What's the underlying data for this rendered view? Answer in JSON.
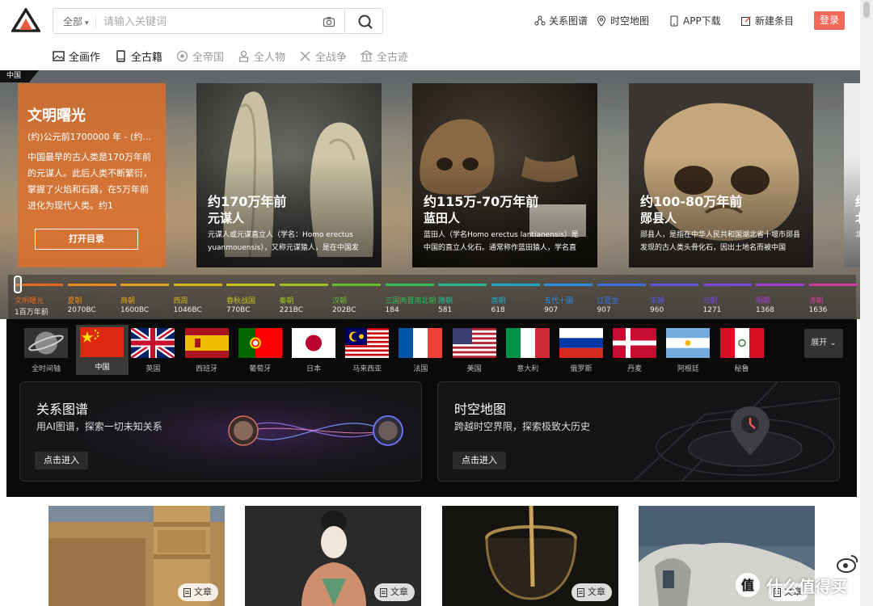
{
  "header": {
    "search": {
      "scope": "全部",
      "placeholder": "请输入关键词"
    },
    "nav": [
      {
        "label": "关系图谱",
        "icon": "relation-graph-icon"
      },
      {
        "label": "时空地图",
        "icon": "map-pin-icon"
      },
      {
        "label": "APP下载",
        "icon": "phone-icon"
      },
      {
        "label": "新建条目",
        "icon": "edit-icon"
      }
    ],
    "login": "登录"
  },
  "categories": [
    {
      "label": "全画作",
      "active": true
    },
    {
      "label": "全古籍",
      "active": true
    },
    {
      "label": "全帝国",
      "active": false
    },
    {
      "label": "全人物",
      "active": false
    },
    {
      "label": "全战争",
      "active": false
    },
    {
      "label": "全古迹",
      "active": false
    }
  ],
  "hero": {
    "region_tag": "中国",
    "intro": {
      "title": "文明曙光",
      "date": "(约)公元前1700000 年 - (约...",
      "text": "中国最早的古人类是170万年前的元谋人。此后人类不断繁衍，掌握了火焰和石器，在5万年前进化为现代人类。约1",
      "button": "打开目录"
    },
    "cards": [
      {
        "date": "约170万年前",
        "name": "元谋人",
        "desc": "元谋人或元谋直立人（学名：Homo erectus yuanmouensis），又称元谋猿人，是在中国发"
      },
      {
        "date": "约115万-70万年前",
        "name": "蓝田人",
        "desc": "蓝田人（学名Homo erectus lantianensis）是中国的直立人化石。通常称作蓝田猿人，学名直"
      },
      {
        "date": "约100-80万年前",
        "name": "郧县人",
        "desc": "郧县人，是指在中华人民共和国湖北省十堰市郧县发现的古人类头骨化石，因出土地名而被中国"
      },
      {
        "date": "约",
        "name": "北",
        "desc": "北"
      }
    ],
    "timeline": [
      {
        "name": "文明曙光",
        "year": "1百万年前",
        "color": "#e2691e"
      },
      {
        "name": "夏朝",
        "year": "2070BC",
        "color": "#e88a1c"
      },
      {
        "name": "商朝",
        "year": "1600BC",
        "color": "#e0a21b"
      },
      {
        "name": "西周",
        "year": "1046BC",
        "color": "#d6b51b"
      },
      {
        "name": "春秋战国",
        "year": "770BC",
        "color": "#c6c21e"
      },
      {
        "name": "秦朝",
        "year": "221BC",
        "color": "#9ec21f"
      },
      {
        "name": "汉朝",
        "year": "202BC",
        "color": "#66bf2a"
      },
      {
        "name": "三国两晋南北朝",
        "year": "184",
        "color": "#2fbf55"
      },
      {
        "name": "隋朝",
        "year": "581",
        "color": "#23b894"
      },
      {
        "name": "唐朝",
        "year": "618",
        "color": "#20a9c6"
      },
      {
        "name": "五代十国",
        "year": "907",
        "color": "#2a8fe0"
      },
      {
        "name": "辽夏金",
        "year": "907",
        "color": "#3d6fe3"
      },
      {
        "name": "宋朝",
        "year": "960",
        "color": "#5b56df"
      },
      {
        "name": "元朝",
        "year": "1271",
        "color": "#7a45d9"
      },
      {
        "name": "明朝",
        "year": "1368",
        "color": "#a23fd0"
      },
      {
        "name": "清朝",
        "year": "1636",
        "color": "#d03a9a"
      }
    ]
  },
  "countries": [
    {
      "label": "全时间轴",
      "key": "globe"
    },
    {
      "label": "中国",
      "key": "cn"
    },
    {
      "label": "英国",
      "key": "gb"
    },
    {
      "label": "西班牙",
      "key": "es"
    },
    {
      "label": "葡萄牙",
      "key": "pt"
    },
    {
      "label": "日本",
      "key": "jp"
    },
    {
      "label": "马来西亚",
      "key": "my"
    },
    {
      "label": "法国",
      "key": "fr"
    },
    {
      "label": "美国",
      "key": "us"
    },
    {
      "label": "意大利",
      "key": "it"
    },
    {
      "label": "俄罗斯",
      "key": "ru"
    },
    {
      "label": "丹麦",
      "key": "dk"
    },
    {
      "label": "阿根廷",
      "key": "ar"
    },
    {
      "label": "秘鲁",
      "key": "pe"
    }
  ],
  "selected_country": "中国",
  "expand": "展开",
  "features": [
    {
      "title": "关系图谱",
      "subtitle": "用AI图谱，探索一切未知关系",
      "button": "点击进入"
    },
    {
      "title": "时空地图",
      "subtitle": "跨越时空界限，探索极致大历史",
      "button": "点击进入"
    }
  ],
  "tiles": [
    {
      "tag": "文章"
    },
    {
      "tag": "文章"
    },
    {
      "tag": "文章"
    },
    {
      "tag": "文章"
    }
  ],
  "watermark": "什么值得买"
}
